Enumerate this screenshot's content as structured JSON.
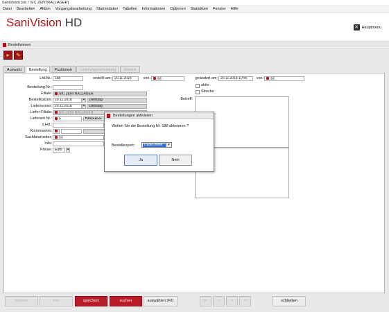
{
  "window": {
    "title": "SaniVision [sic / SIC ZENTRALLAGER]"
  },
  "menu": [
    "Datei",
    "Bearbeiten",
    "Aktion",
    "Vorgangsbearbeitung",
    "Stammdaten",
    "Tabellen",
    "Informationen",
    "Optionen",
    "Statistiken",
    "Fenster",
    "Hilfe"
  ],
  "brand": {
    "name_a": "SaniVision",
    "name_b": " HD",
    "hauptmenu": "Hauptmenü"
  },
  "module": {
    "title": "Bestellwesen"
  },
  "tabs": [
    "Auswahl",
    "Bestellung",
    "Positionen",
    "Lieferungsverwaltung",
    "Historie"
  ],
  "form": {
    "lfdnr_label": "Lfd.Nr.:",
    "lfdnr_value": "188",
    "erstellt_label": "erstellt am:",
    "erstellt_value": "20.11.2018",
    "von_label": "von:",
    "von_value": "sic",
    "geaendert_label": "geändert am:",
    "geaendert_value": "20.11.2018 10:46",
    "von2_label": "von:",
    "von2_value": "sic",
    "bestellung_nr_label": "Bestellung Nr.:",
    "filiale_label": "Filiale:",
    "filiale_value": "SIC ZENTRALLAGER",
    "bestelldatum_label": "Bestelldatum:",
    "bestelldatum_value": "20.11.2018",
    "bestelldatum_day": "Dienstag",
    "liefertermin_label": "Liefertermin:",
    "liefertermin_value": "20.11.2018",
    "liefertermin_day": "Dienstag",
    "lieferfiliale_label": "Liefer-Filiale:",
    "lieferfiliale_value": "SIC ZENTRALLAGER",
    "lieferant_label": "Lieferant Nr.:",
    "lieferant_value": "5",
    "lieferant_name": "BAUERFE",
    "zhd_label": "z.Hd.:",
    "kommission_label": "Kommission:",
    "sachbearbeiter_label": "Sachbearbeiter:",
    "sachbearbeiter_value": "sic",
    "info_label": "Info:",
    "preise_label": "Preise:",
    "preise_value": "Euro",
    "aktiv_label": "aktiv",
    "strecke_label": "Strecke",
    "betreff_label": "Betreff:"
  },
  "bottom": {
    "loeschen": "löschen",
    "neu": "neu",
    "speichern": "speichern",
    "suchen": "suchen",
    "auswaehlen": "auswählen (F2)",
    "first": "|<",
    "prev": "<",
    "next": ">",
    "last": ">|",
    "schliessen": "schließen"
  },
  "dialog": {
    "title": "Bestellungen aktivieren",
    "message": "Wollen Sie die Bestellung Nr. 188 aktivieren ?",
    "export_label": "Bestellexport:",
    "export_value": "TradeOnline",
    "yes": "Ja",
    "no": "Nein"
  },
  "colors": {
    "brand_red": "#b5121b",
    "button_red": "#b91d2a",
    "select_blue": "#2f6fd1"
  }
}
